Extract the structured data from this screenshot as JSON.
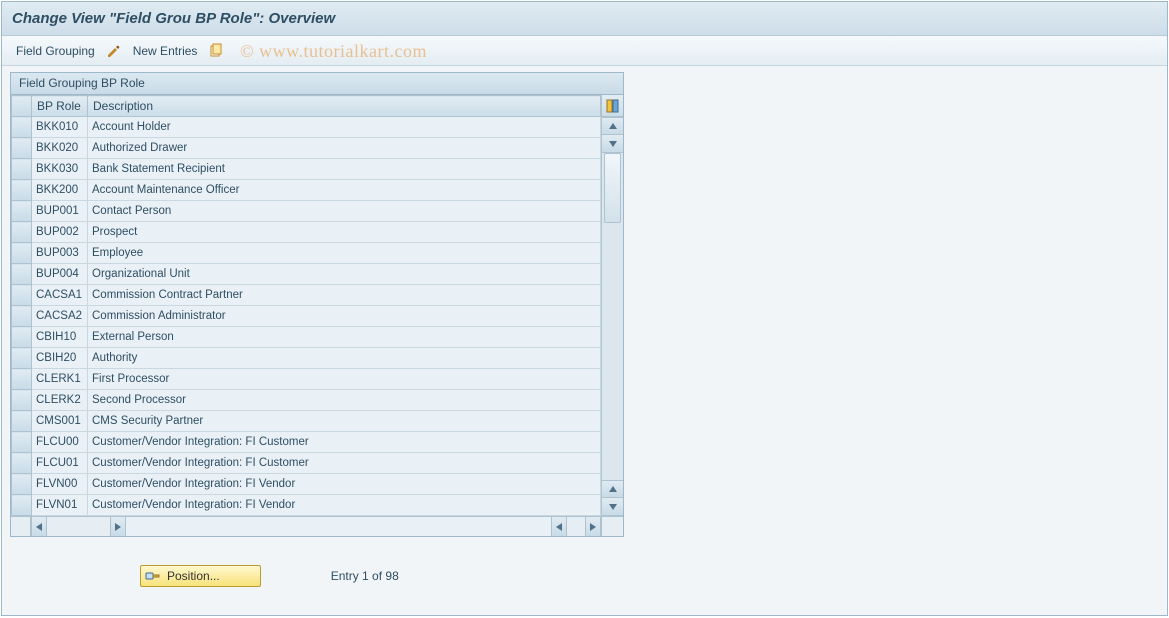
{
  "page_title": "Change View \"Field Grou BP Role\": Overview",
  "toolbar": {
    "field_grouping_label": "Field Grouping",
    "new_entries_label": "New Entries"
  },
  "panel": {
    "header": "Field Grouping BP Role"
  },
  "table": {
    "columns": {
      "role": "BP Role",
      "description": "Description"
    },
    "rows": [
      {
        "role": "BKK010",
        "description": "Account Holder"
      },
      {
        "role": "BKK020",
        "description": "Authorized Drawer"
      },
      {
        "role": "BKK030",
        "description": "Bank Statement Recipient"
      },
      {
        "role": "BKK200",
        "description": "Account Maintenance Officer"
      },
      {
        "role": "BUP001",
        "description": "Contact Person"
      },
      {
        "role": "BUP002",
        "description": "Prospect"
      },
      {
        "role": "BUP003",
        "description": "Employee"
      },
      {
        "role": "BUP004",
        "description": "Organizational Unit"
      },
      {
        "role": "CACSA1",
        "description": "Commission Contract Partner"
      },
      {
        "role": "CACSA2",
        "description": "Commission Administrator"
      },
      {
        "role": "CBIH10",
        "description": "External Person"
      },
      {
        "role": "CBIH20",
        "description": "Authority"
      },
      {
        "role": "CLERK1",
        "description": "First Processor"
      },
      {
        "role": "CLERK2",
        "description": "Second Processor"
      },
      {
        "role": "CMS001",
        "description": "CMS Security Partner"
      },
      {
        "role": "FLCU00",
        "description": "Customer/Vendor Integration: FI Customer"
      },
      {
        "role": "FLCU01",
        "description": "Customer/Vendor Integration: FI Customer"
      },
      {
        "role": "FLVN00",
        "description": "Customer/Vendor Integration: FI Vendor"
      },
      {
        "role": "FLVN01",
        "description": "Customer/Vendor Integration: FI Vendor"
      }
    ]
  },
  "footer": {
    "position_label": "Position...",
    "entry_text": "Entry 1 of 98"
  },
  "watermark": "© www.tutorialkart.com"
}
